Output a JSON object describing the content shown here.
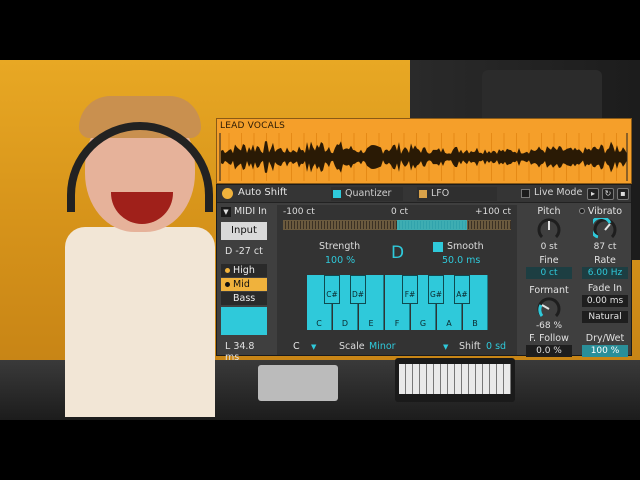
{
  "waveform": {
    "title": "LEAD VOCALS",
    "color": "#f59f2a"
  },
  "device": {
    "title": "Auto Shift",
    "tabs": [
      {
        "label": "Quantizer",
        "color": "#2fc9da"
      },
      {
        "label": "LFO",
        "color": "#d9a24a"
      }
    ],
    "live_mode": "Live Mode"
  },
  "left": {
    "midi_in": "MIDI In",
    "input_button": "Input",
    "detune": "D -27 ct",
    "ranges": [
      "High",
      "Mid",
      "Bass"
    ],
    "latency": "L 34.8 ms"
  },
  "quantizer": {
    "min_ct": "-100 ct",
    "zero_ct": "0 ct",
    "max_ct": "+100 ct",
    "strength_label": "Strength",
    "strength_value": "100 %",
    "key": "D",
    "smooth_label": "Smooth",
    "smooth_value": "50.0 ms",
    "white_keys": [
      "C",
      "D",
      "E",
      "F",
      "G",
      "A",
      "B"
    ],
    "black_keys": [
      "C#",
      "D#",
      "F#",
      "G#",
      "A#"
    ],
    "root": "C",
    "scale_label": "Scale",
    "scale_value": "Minor",
    "shift_label": "Shift",
    "shift_value": "0 sd"
  },
  "formant_col": {
    "pitch_label": "Pitch",
    "pitch_value": "0 st",
    "fine_label": "Fine",
    "fine_value": "0 ct",
    "formant_label": "Formant",
    "formant_value": "-68 %",
    "follow_label": "F. Follow",
    "follow_value": "0.0 %"
  },
  "vibrato_col": {
    "vibrato_label": "Vibrato",
    "vibrato_value": "87 ct",
    "rate_label": "Rate",
    "rate_value": "6.00 Hz",
    "fadein_label": "Fade In",
    "fadein_value": "0.00 ms",
    "mode_value": "Natural",
    "drywet_label": "Dry/Wet",
    "drywet_value": "100 %"
  },
  "colors": {
    "accent": "#2fc9da",
    "orange": "#f0b23c",
    "panel": "#3f3f3f"
  }
}
